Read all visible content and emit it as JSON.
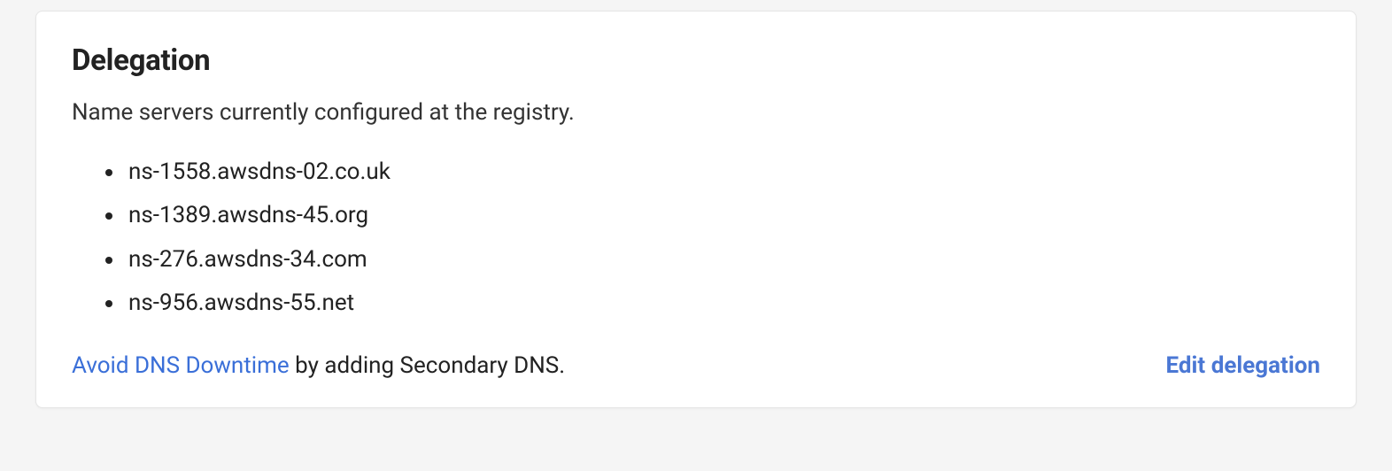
{
  "card": {
    "title": "Delegation",
    "description": "Name servers currently configured at the registry.",
    "name_servers": [
      "ns-1558.awsdns-02.co.uk",
      "ns-1389.awsdns-45.org",
      "ns-276.awsdns-34.com",
      "ns-956.awsdns-55.net"
    ],
    "footer": {
      "link_text": "Avoid DNS Downtime",
      "trailing_text": " by adding Secondary DNS."
    },
    "action": {
      "edit_label": "Edit delegation"
    }
  }
}
